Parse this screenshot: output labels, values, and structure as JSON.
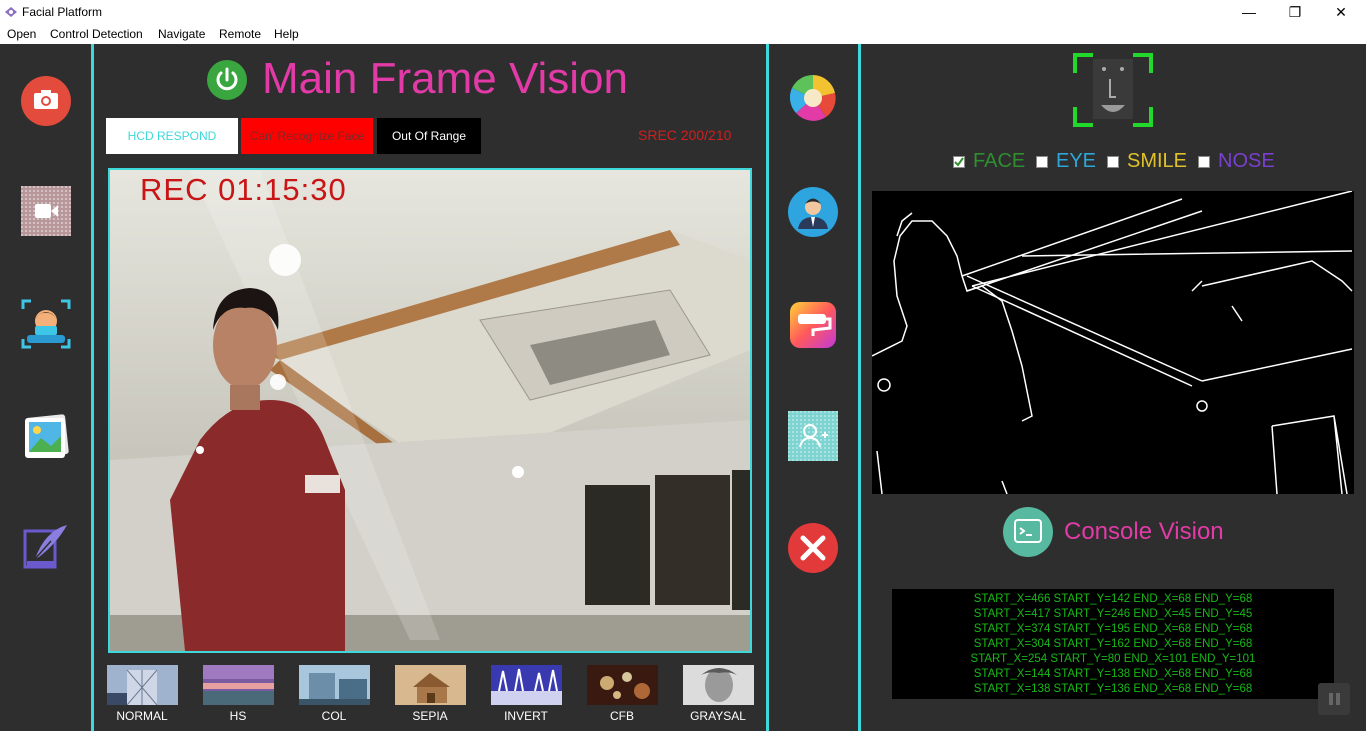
{
  "window": {
    "title": "Facial Platform",
    "minimize": "—",
    "maximize": "❐",
    "close": "✕"
  },
  "menu": [
    "Open",
    "Control Detection",
    "Navigate",
    "Remote",
    "Help"
  ],
  "left_sidebar": [
    {
      "icon": "camera-icon"
    },
    {
      "icon": "video-icon"
    },
    {
      "icon": "face-scan-icon"
    },
    {
      "icon": "gallery-icon"
    },
    {
      "icon": "feather-pen-icon"
    }
  ],
  "header": {
    "title": "Main Frame Vision",
    "power_icon": "power-icon"
  },
  "status": {
    "hcd": "HCD RESPOND",
    "face": "Can' Recognize Face",
    "range": "Out Of Range",
    "srec": "SREC 200/210"
  },
  "video": {
    "rec": "REC  01:15:30"
  },
  "filters": [
    "NORMAL",
    "HS",
    "COL",
    "SEPIA",
    "INVERT",
    "CFB",
    "GRAYSAL"
  ],
  "mid_sidebar": [
    {
      "icon": "color-wheel-icon"
    },
    {
      "icon": "user-avatar-icon"
    },
    {
      "icon": "paint-roller-icon"
    },
    {
      "icon": "add-user-icon"
    },
    {
      "icon": "close-circle-icon"
    }
  ],
  "detection": {
    "checks": [
      {
        "label": "FACE",
        "checked": true,
        "color": "#2f8f2f"
      },
      {
        "label": "EYE",
        "checked": false,
        "color": "#2ea6d8"
      },
      {
        "label": "SMILE",
        "checked": false,
        "color": "#e0c12b"
      },
      {
        "label": "NOSE",
        "checked": false,
        "color": "#7b3fd0"
      }
    ]
  },
  "console": {
    "title": "Console Vision",
    "lines": [
      "START_X=466 START_Y=142 END_X=68 END_Y=68",
      "START_X=417 START_Y=246 END_X=45 END_Y=45",
      "START_X=374 START_Y=195 END_X=68 END_Y=68",
      "START_X=304 START_Y=162 END_X=68 END_Y=68",
      "START_X=254 START_Y=80 END_X=101 END_Y=101",
      "START_X=144 START_Y=138 END_X=68 END_Y=68",
      "START_X=138 START_Y=136 END_X=68 END_Y=68"
    ]
  },
  "colors": {
    "accent": "#3fd8da",
    "title": "#e23ba8",
    "panel": "#2e2e2e",
    "console_text": "#18b818"
  }
}
